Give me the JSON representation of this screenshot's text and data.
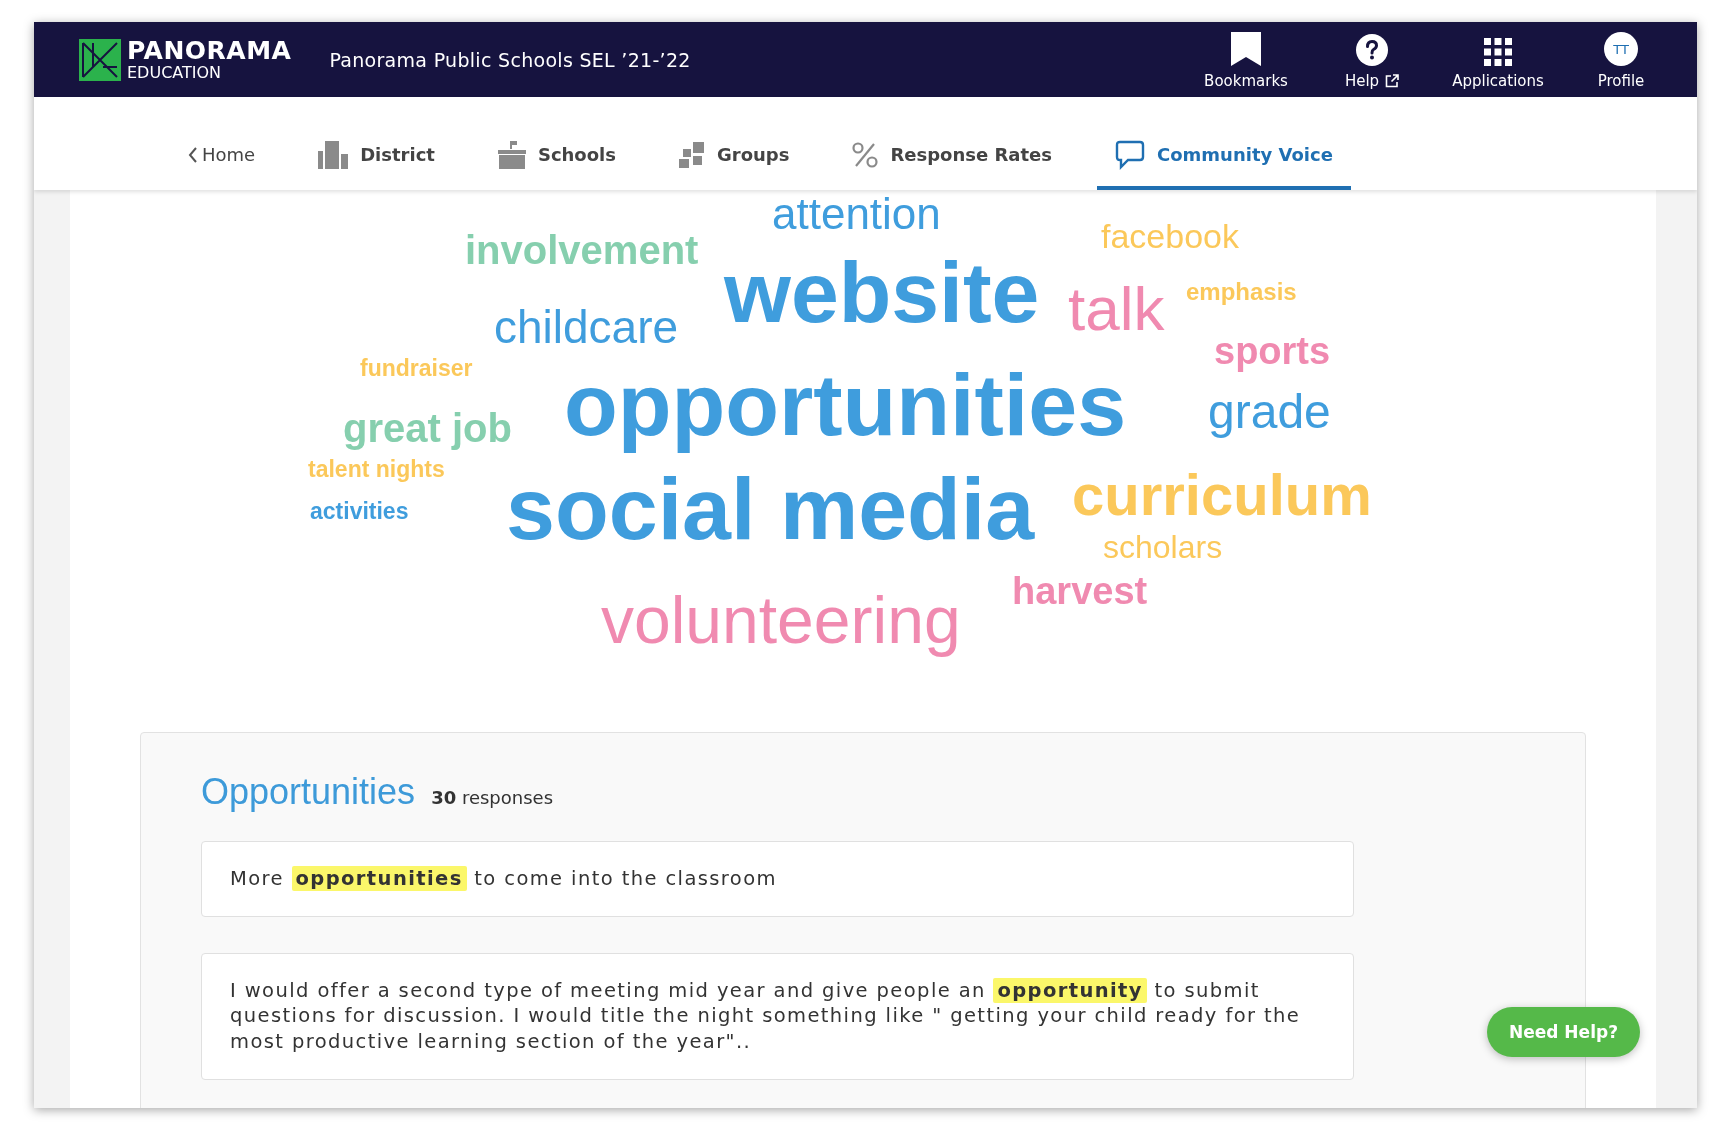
{
  "header": {
    "logo": {
      "name": "PANORAMA",
      "subtitle": "EDUCATION"
    },
    "title": "Panorama Public Schools SEL ’21-’22",
    "actions": [
      {
        "kind": "bookmark",
        "label": "Bookmarks"
      },
      {
        "kind": "help",
        "label": "Help"
      },
      {
        "kind": "apps",
        "label": "Applications"
      },
      {
        "kind": "profile",
        "label": "Profile",
        "initials": "TT"
      }
    ]
  },
  "tabs": [
    {
      "kind": "back",
      "label": "Home",
      "selected": false
    },
    {
      "kind": "district",
      "label": "District",
      "selected": false
    },
    {
      "kind": "schools",
      "label": "Schools",
      "selected": false
    },
    {
      "kind": "groups",
      "label": "Groups",
      "selected": false
    },
    {
      "kind": "rates",
      "label": "Response Rates",
      "selected": false
    },
    {
      "kind": "voice",
      "label": "Community Voice",
      "selected": true
    }
  ],
  "word_cloud": [
    {
      "text": "attention",
      "kind": "light",
      "color": "#3f9ddd"
    },
    {
      "text": "involvement",
      "kind": "bold",
      "color": "#86cfae"
    },
    {
      "text": "childcare",
      "kind": "light",
      "color": "#3f9ddd"
    },
    {
      "text": "website",
      "kind": "bold",
      "color": "#3f9ddd"
    },
    {
      "text": "facebook",
      "kind": "light",
      "color": "#fbc85a"
    },
    {
      "text": "talk",
      "kind": "light",
      "color": "#f08ab0"
    },
    {
      "text": "emphasis",
      "kind": "bold",
      "color": "#fbc85a"
    },
    {
      "text": "fundraiser",
      "kind": "bold",
      "color": "#fbc85a"
    },
    {
      "text": "sports",
      "kind": "bold",
      "color": "#f08ab0"
    },
    {
      "text": "great job",
      "kind": "bold",
      "color": "#86cfae"
    },
    {
      "text": "opportunities",
      "kind": "bold",
      "color": "#3f9ddd"
    },
    {
      "text": "grade",
      "kind": "light",
      "color": "#3f9ddd"
    },
    {
      "text": "talent nights",
      "kind": "bold",
      "color": "#fbc85a"
    },
    {
      "text": "activities",
      "kind": "bold",
      "color": "#3f9ddd"
    },
    {
      "text": "social media",
      "kind": "bold",
      "color": "#3f9ddd"
    },
    {
      "text": "curriculum",
      "kind": "bold",
      "color": "#fbc85a"
    },
    {
      "text": "scholars",
      "kind": "light",
      "color": "#fbc85a"
    },
    {
      "text": "volunteering",
      "kind": "light",
      "color": "#f08ab0"
    },
    {
      "text": "harvest",
      "kind": "bold",
      "color": "#f08ab0"
    }
  ],
  "responses_panel": {
    "title": "Opportunities",
    "count": "30",
    "count_label": "responses",
    "responses": [
      "More **opportunities** to come into the classroom",
      "I would offer a second type of meeting mid year and give people an **opportunity** to submit questions for discussion. I would title the night something like \" getting your child ready for the most productive learning section of the year\".."
    ]
  },
  "help_button": "Need Help?"
}
